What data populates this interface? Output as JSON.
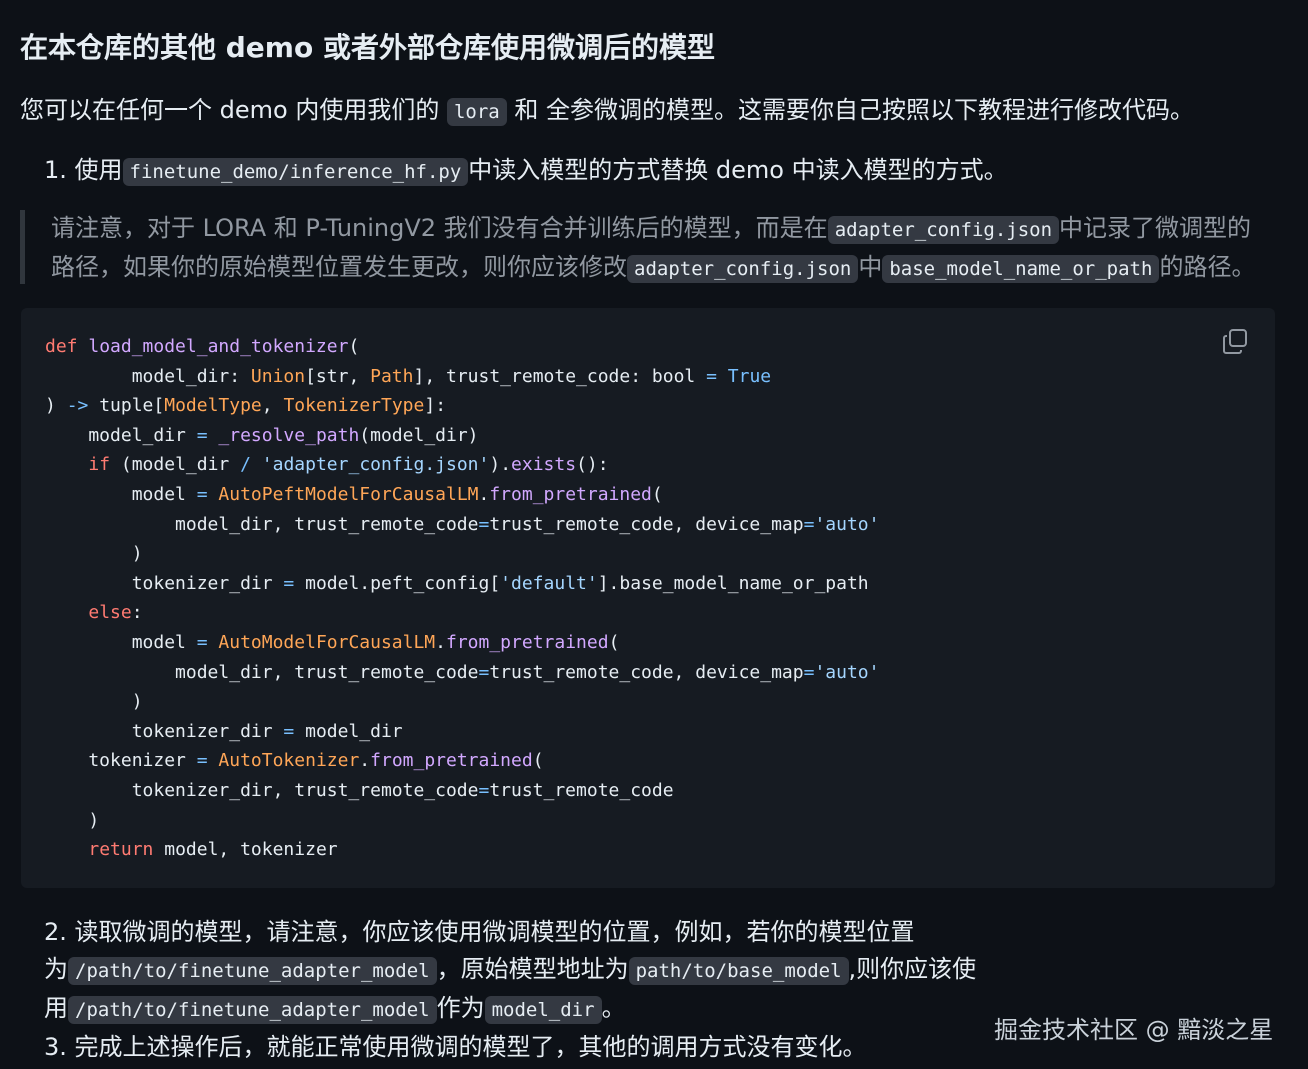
{
  "heading": "在本仓库的其他 demo 或者外部仓库使用微调后的模型",
  "intro": {
    "before": "您可以在任何一个 demo 内使用我们的 ",
    "code": "lora",
    "after": " 和 全参微调的模型。这需要你自己按照以下教程进行修改代码。"
  },
  "step1": {
    "num": "1.",
    "before": "使用",
    "code": "finetune_demo/inference_hf.py",
    "after": "中读入模型的方式替换 demo 中读入模型的方式。"
  },
  "note": {
    "t1": "请注意，对于 LORA 和 P-TuningV2 我们没有合并训练后的模型，而是在",
    "c1": "adapter_config.json",
    "t2": "中记录了微调型的路径，如果你的原始模型位置发生更改，则你应该修改",
    "c2": "adapter_config.json",
    "t3": "中",
    "c3": "base_model_name_or_path",
    "t4": "的路径。"
  },
  "code_lines": [
    [
      [
        "k",
        "def "
      ],
      [
        "f",
        "load_model_and_tokenizer"
      ],
      [
        "p",
        "("
      ]
    ],
    [
      [
        "p",
        "        model_dir: "
      ],
      [
        "c",
        "Union"
      ],
      [
        "p",
        "[str, "
      ],
      [
        "c",
        "Path"
      ],
      [
        "p",
        "], trust_remote_code: bool "
      ],
      [
        "o",
        "="
      ],
      [
        "p",
        " "
      ],
      [
        "b",
        "True"
      ]
    ],
    [
      [
        "p",
        ") "
      ],
      [
        "o",
        "->"
      ],
      [
        "p",
        " tuple["
      ],
      [
        "c",
        "ModelType"
      ],
      [
        "p",
        ", "
      ],
      [
        "c",
        "TokenizerType"
      ],
      [
        "p",
        "]:"
      ]
    ],
    [
      [
        "p",
        "    model_dir "
      ],
      [
        "o",
        "="
      ],
      [
        "p",
        " "
      ],
      [
        "f",
        "_resolve_path"
      ],
      [
        "p",
        "(model_dir)"
      ]
    ],
    [
      [
        "p",
        "    "
      ],
      [
        "k",
        "if"
      ],
      [
        "p",
        " (model_dir "
      ],
      [
        "o",
        "/"
      ],
      [
        "p",
        " "
      ],
      [
        "s",
        "'adapter_config.json'"
      ],
      [
        "p",
        ")."
      ],
      [
        "f",
        "exists"
      ],
      [
        "p",
        "():"
      ]
    ],
    [
      [
        "p",
        "        model "
      ],
      [
        "o",
        "="
      ],
      [
        "p",
        " "
      ],
      [
        "c",
        "AutoPeftModelForCausalLM"
      ],
      [
        "p",
        "."
      ],
      [
        "f",
        "from_pretrained"
      ],
      [
        "p",
        "("
      ]
    ],
    [
      [
        "p",
        "            model_dir, trust_remote_code"
      ],
      [
        "o",
        "="
      ],
      [
        "p",
        "trust_remote_code, device_map"
      ],
      [
        "o",
        "="
      ],
      [
        "s",
        "'auto'"
      ]
    ],
    [
      [
        "p",
        "        )"
      ]
    ],
    [
      [
        "p",
        "        tokenizer_dir "
      ],
      [
        "o",
        "="
      ],
      [
        "p",
        " model.peft_config["
      ],
      [
        "s",
        "'default'"
      ],
      [
        "p",
        "].base_model_name_or_path"
      ]
    ],
    [
      [
        "p",
        "    "
      ],
      [
        "k",
        "else"
      ],
      [
        "p",
        ":"
      ]
    ],
    [
      [
        "p",
        "        model "
      ],
      [
        "o",
        "="
      ],
      [
        "p",
        " "
      ],
      [
        "c",
        "AutoModelForCausalLM"
      ],
      [
        "p",
        "."
      ],
      [
        "f",
        "from_pretrained"
      ],
      [
        "p",
        "("
      ]
    ],
    [
      [
        "p",
        "            model_dir, trust_remote_code"
      ],
      [
        "o",
        "="
      ],
      [
        "p",
        "trust_remote_code, device_map"
      ],
      [
        "o",
        "="
      ],
      [
        "s",
        "'auto'"
      ]
    ],
    [
      [
        "p",
        "        )"
      ]
    ],
    [
      [
        "p",
        "        tokenizer_dir "
      ],
      [
        "o",
        "="
      ],
      [
        "p",
        " model_dir"
      ]
    ],
    [
      [
        "p",
        "    tokenizer "
      ],
      [
        "o",
        "="
      ],
      [
        "p",
        " "
      ],
      [
        "c",
        "AutoTokenizer"
      ],
      [
        "p",
        "."
      ],
      [
        "f",
        "from_pretrained"
      ],
      [
        "p",
        "("
      ]
    ],
    [
      [
        "p",
        "        tokenizer_dir, trust_remote_code"
      ],
      [
        "o",
        "="
      ],
      [
        "p",
        "trust_remote_code"
      ]
    ],
    [
      [
        "p",
        "    )"
      ]
    ],
    [
      [
        "p",
        "    "
      ],
      [
        "k",
        "return"
      ],
      [
        "p",
        " model, tokenizer"
      ]
    ]
  ],
  "step2": {
    "num": "2.",
    "t1": "读取微调的模型，请注意，你应该使用微调模型的位置，例如，若你的模型位置为",
    "c1": "/path/to/finetune_adapter_model",
    "t2": "，原始模型地址为",
    "c2": "path/to/base_model",
    "t3": ",则你应该使用",
    "c3": "/path/to/finetune_adapter_model",
    "t4": "作为",
    "c4": "model_dir",
    "t5": "。"
  },
  "step3": {
    "num": "3.",
    "text": "完成上述操作后，就能正常使用微调的模型了，其他的调用方式没有变化。"
  },
  "watermark": "掘金技术社区 @ 黯淡之星",
  "icons": {
    "copy": "copy-icon"
  },
  "colors": {
    "background": "#0d1117",
    "code_background": "#161b22",
    "keyword": "#ff7b72",
    "function": "#d2a8ff",
    "class": "#ffa657",
    "string": "#a5d6ff",
    "builtin": "#79c0ff"
  }
}
